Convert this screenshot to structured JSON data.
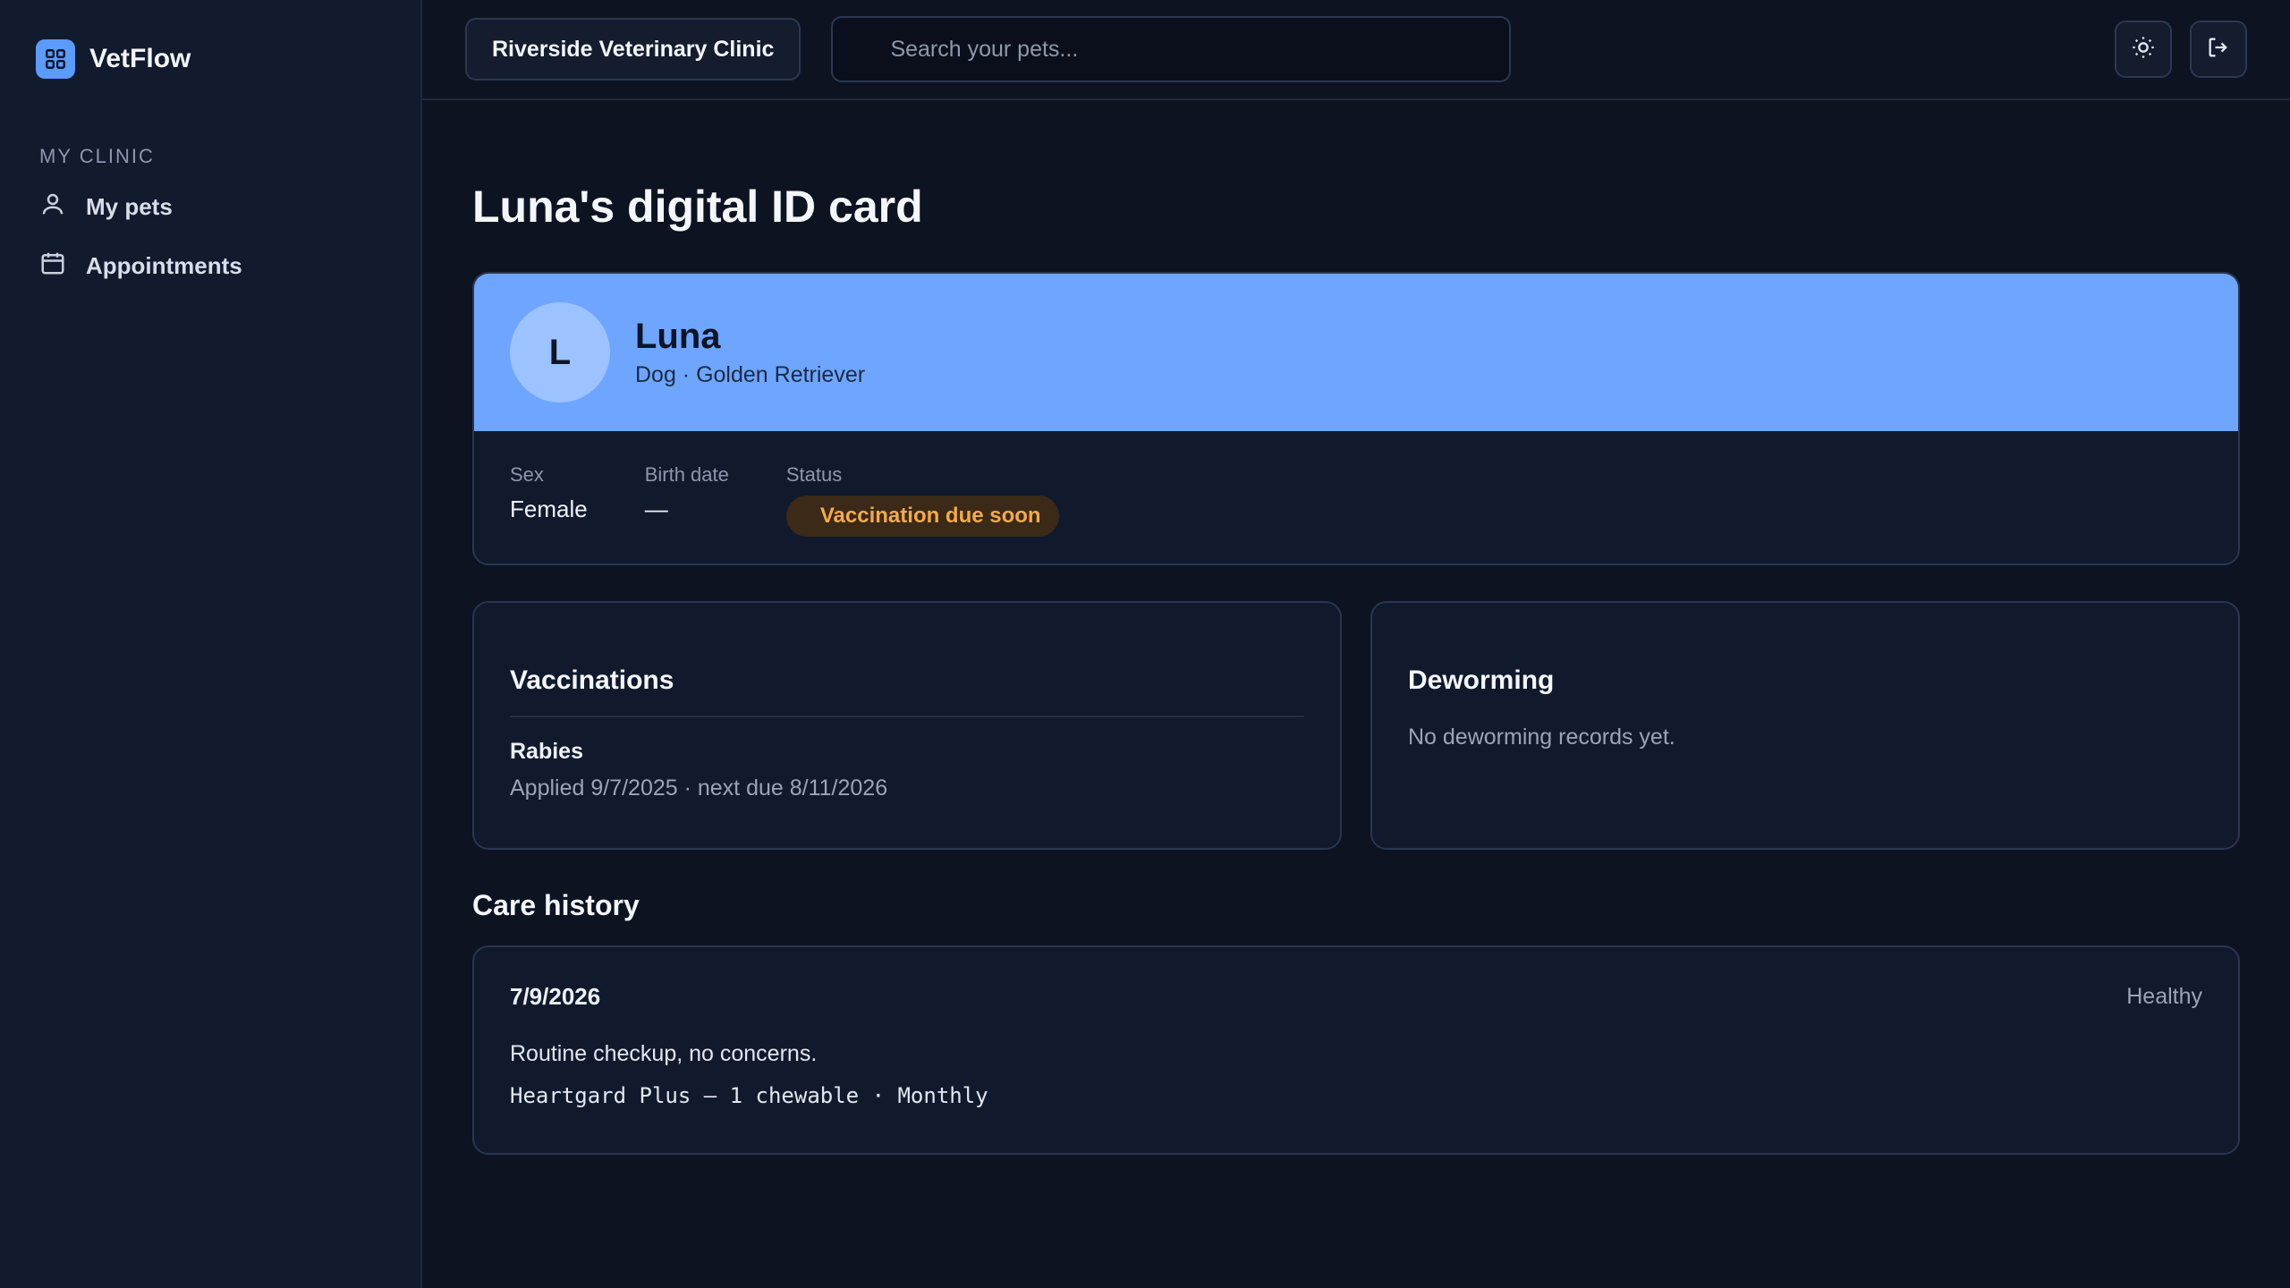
{
  "brand": {
    "name": "VetFlow",
    "logo_icon": "grid-icon",
    "accent": "#5b9bff"
  },
  "sidebar": {
    "section": "MY CLINIC",
    "items": [
      {
        "label": "My pets",
        "icon": "user-icon"
      },
      {
        "label": "Appointments",
        "icon": "calendar-icon"
      }
    ]
  },
  "topbar": {
    "clinic": "Riverside Veterinary Clinic",
    "search_placeholder": "Search your pets...",
    "theme_icon": "sun-icon",
    "logout_icon": "logout-icon"
  },
  "page": {
    "title": "Luna's digital ID card"
  },
  "pet": {
    "initial": "L",
    "name": "Luna",
    "breed": "Dog · Golden Retriever",
    "fields": {
      "sex_label": "Sex",
      "sex": "Female",
      "birth_label": "Birth date",
      "birth": "—",
      "status_label": "Status",
      "status": "Vaccination due soon"
    },
    "header_color": "#6ea6ff",
    "status_color": "#f5a94a"
  },
  "vaccinations": {
    "title": "Vaccinations",
    "items": [
      {
        "name": "Rabies",
        "detail": "Applied 9/7/2025 · next due 8/11/2026"
      }
    ]
  },
  "deworming": {
    "title": "Deworming",
    "empty": "No deworming records yet."
  },
  "history": {
    "title": "Care history",
    "entries": [
      {
        "date": "7/9/2026",
        "status": "Healthy",
        "note": "Routine checkup, no concerns.",
        "medication": "Heartgard Plus — 1 chewable · Monthly"
      }
    ]
  }
}
